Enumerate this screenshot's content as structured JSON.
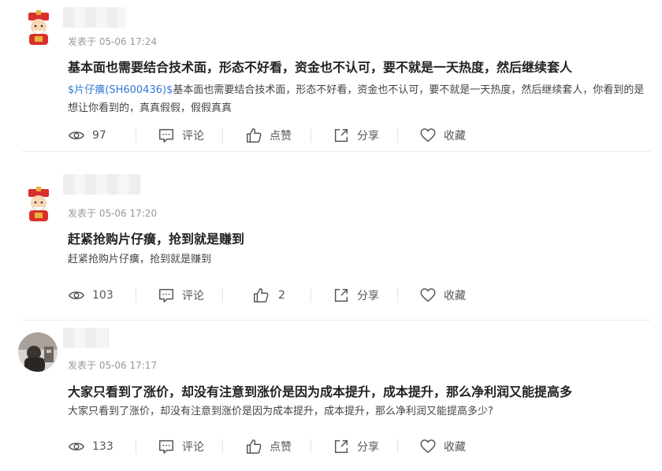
{
  "posts": [
    {
      "time": "发表于 05-06 17:24",
      "title": "基本面也需要结合技术面，形态不好看，资金也不认可，要不就是一天热度，然后继续套人",
      "stock_tag": "$片仔癀(SH600436)$",
      "body": "基本面也需要结合技术面，形态不好看，资金也不认可，要不就是一天热度，然后继续套人，你看到的是想让你看到的，真真假假，假假真真",
      "views": "97",
      "comment_label": "评论",
      "like_label": "点赞",
      "share_label": "分享",
      "collect_label": "收藏"
    },
    {
      "time": "发表于 05-06 17:20",
      "title": "赶紧抢购片仔癀，抢到就是赚到",
      "stock_tag": "",
      "body": "赶紧抢购片仔癀，抢到就是赚到",
      "views": "103",
      "comment_label": "评论",
      "like_label": "2",
      "share_label": "分享",
      "collect_label": "收藏"
    },
    {
      "time": "发表于 05-06 17:17",
      "title": "大家只看到了涨价，却没有注意到涨价是因为成本提升，成本提升，那么净利润又能提高多",
      "stock_tag": "",
      "body": "大家只看到了涨价，却没有注意到涨价是因为成本提升，成本提升，那么净利润又能提高多少?",
      "views": "133",
      "comment_label": "评论",
      "like_label": "点赞",
      "share_label": "分享",
      "collect_label": "收藏"
    }
  ],
  "icons": {
    "views": "eye-icon",
    "comment": "comment-icon",
    "like": "thumbs-up-icon",
    "share": "share-icon",
    "collect": "heart-icon"
  },
  "colors": {
    "link": "#2f78d8",
    "meta": "#999999",
    "title": "#222222"
  }
}
